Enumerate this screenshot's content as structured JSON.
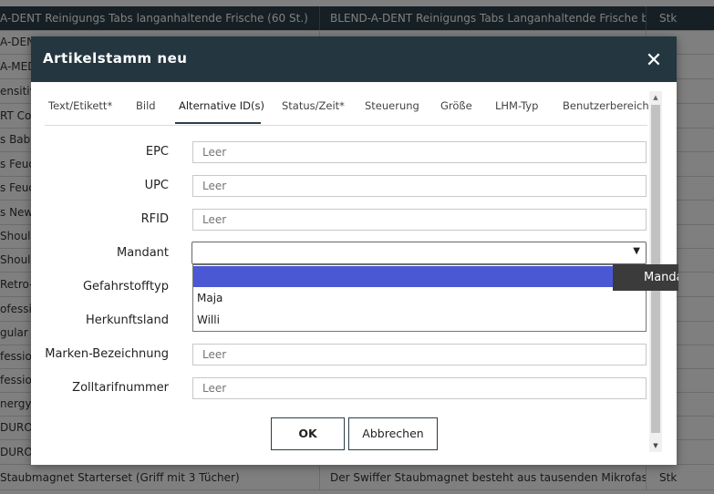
{
  "background_table": {
    "rows": [
      {
        "col1": "A-DENT Reinigungs Tabs langanhaltende Frische (60 St.)",
        "col2": "BLEND-A-DENT Reinigungs Tabs Langanhaltende Frische biet",
        "col3": "Stk",
        "selected": true
      },
      {
        "col1": "A-DEN",
        "col2": "",
        "col3": "",
        "selected": false
      },
      {
        "col1": "A-MED",
        "col2": "",
        "col3": "",
        "selected": false
      },
      {
        "col1": "ensitiv",
        "col2": "",
        "col3": "",
        "selected": false
      },
      {
        "col1": "RT Co",
        "col2": "",
        "col3": "",
        "selected": false
      },
      {
        "col1": "s Baby",
        "col2": "",
        "col3": "",
        "selected": false
      },
      {
        "col1": "s Feuc",
        "col2": "",
        "col3": "",
        "selected": false
      },
      {
        "col1": "s Feuc",
        "col2": "",
        "col3": "",
        "selected": false
      },
      {
        "col1": "s New",
        "col2": "",
        "col3": "",
        "selected": false
      },
      {
        "col1": "Should",
        "col2": "",
        "col3": "",
        "selected": false
      },
      {
        "col1": "Should",
        "col2": "",
        "col3": "",
        "selected": false
      },
      {
        "col1": "Retro-",
        "col2": "",
        "col3": "",
        "selected": false
      },
      {
        "col1": "ofessi",
        "col2": "",
        "col3": "",
        "selected": false
      },
      {
        "col1": "gular G",
        "col2": "",
        "col3": "",
        "selected": false
      },
      {
        "col1": "fessio",
        "col2": "",
        "col3": "",
        "selected": false
      },
      {
        "col1": "fessio",
        "col2": "",
        "col3": "",
        "selected": false
      },
      {
        "col1": "nergy C",
        "col2": "",
        "col3": "",
        "selected": false
      },
      {
        "col1": "DURO",
        "col2": "",
        "col3": "",
        "selected": false
      },
      {
        "col1": "DURO",
        "col2": "",
        "col3": "",
        "selected": false
      },
      {
        "col1": "Staubmagnet Starterset (Griff mit 3 Tücher)",
        "col2": "Der Swiffer Staubmagnet besteht aus tausenden Mikrofasern",
        "col3": "Stk",
        "selected": false
      }
    ]
  },
  "dialog": {
    "title": "Artikelstamm neu",
    "close_icon": "close-icon",
    "tabs": [
      {
        "label": "Text/Etikett*",
        "active": false
      },
      {
        "label": "Bild",
        "active": false
      },
      {
        "label": "Alternative ID(s)",
        "active": true
      },
      {
        "label": "Status/Zeit*",
        "active": false
      },
      {
        "label": "Steuerung",
        "active": false
      },
      {
        "label": "Größe",
        "active": false
      },
      {
        "label": "LHM-Typ",
        "active": false
      },
      {
        "label": "Benutzerbereich",
        "active": false
      }
    ],
    "fields": {
      "epc": {
        "label": "EPC",
        "placeholder": "Leer",
        "value": ""
      },
      "upc": {
        "label": "UPC",
        "placeholder": "Leer",
        "value": ""
      },
      "rfid": {
        "label": "RFID",
        "placeholder": "Leer",
        "value": ""
      },
      "mandant": {
        "label": "Mandant",
        "value": ""
      },
      "gefahrstofftyp": {
        "label": "Gefahrstofftyp"
      },
      "herkunftsland": {
        "label": "Herkunftsland"
      },
      "marken_bezeichnung": {
        "label": "Marken-Bezeichnung",
        "placeholder": "Leer",
        "value": ""
      },
      "zolltarifnummer": {
        "label": "Zolltarifnummer",
        "placeholder": "Leer",
        "value": ""
      }
    },
    "mandant_dropdown": {
      "options": [
        "",
        "Maja",
        "Willi"
      ],
      "highlighted_index": 0
    },
    "tooltip": "Mandant",
    "buttons": {
      "ok": "OK",
      "cancel": "Abbrechen"
    },
    "colors": {
      "header": "#24363f",
      "highlight": "#4a58d4",
      "selected_row": "#2b3e48"
    }
  }
}
